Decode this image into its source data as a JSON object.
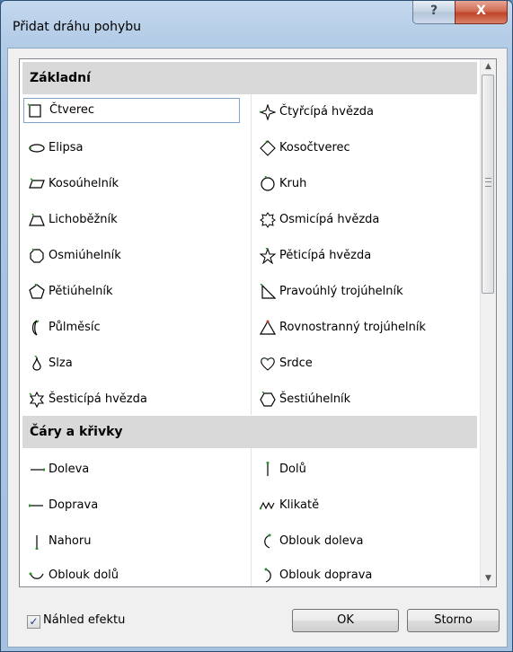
{
  "window": {
    "title": "Přidat dráhu pohybu",
    "help_label": "?",
    "close_label": "X"
  },
  "sections": [
    {
      "title": "Základní",
      "left_items": [
        {
          "label": "Čtverec",
          "icon": "square-icon"
        },
        {
          "label": "Elipsa",
          "icon": "ellipse-icon"
        },
        {
          "label": "Kosoúhelník",
          "icon": "parallelogram-icon"
        },
        {
          "label": "Lichoběžník",
          "icon": "trapezoid-icon"
        },
        {
          "label": "Osmiúhelník",
          "icon": "octagon-icon"
        },
        {
          "label": "Pětiúhelník",
          "icon": "pentagon-icon"
        },
        {
          "label": "Půlměsíc",
          "icon": "crescent-icon"
        },
        {
          "label": "Slza",
          "icon": "teardrop-icon"
        },
        {
          "label": "Šesticípá hvězda",
          "icon": "six-point-star-icon"
        }
      ],
      "right_items": [
        {
          "label": "Čtyřcípá hvězda",
          "icon": "four-point-star-icon"
        },
        {
          "label": "Kosočtverec",
          "icon": "diamond-icon"
        },
        {
          "label": "Kruh",
          "icon": "circle-icon"
        },
        {
          "label": "Osmicípá hvězda",
          "icon": "eight-point-star-icon"
        },
        {
          "label": "Pěticípá hvězda",
          "icon": "five-point-star-icon"
        },
        {
          "label": "Pravoúhlý trojúhelník",
          "icon": "right-triangle-icon"
        },
        {
          "label": "Rovnostranný trojúhelník",
          "icon": "equilateral-triangle-icon"
        },
        {
          "label": "Srdce",
          "icon": "heart-icon"
        },
        {
          "label": "Šestiúhelník",
          "icon": "hexagon-icon"
        }
      ]
    },
    {
      "title": "Čáry a křivky",
      "left_items": [
        {
          "label": "Doleva",
          "icon": "line-left-icon"
        },
        {
          "label": "Doprava",
          "icon": "line-right-icon"
        },
        {
          "label": "Nahoru",
          "icon": "line-up-icon"
        },
        {
          "label": "Oblouk dolů",
          "icon": "arc-down-icon"
        }
      ],
      "right_items": [
        {
          "label": "Dolů",
          "icon": "line-down-icon"
        },
        {
          "label": "Klikatě",
          "icon": "zigzag-icon"
        },
        {
          "label": "Oblouk doleva",
          "icon": "arc-left-icon"
        },
        {
          "label": "Oblouk doprava",
          "icon": "arc-right-icon"
        }
      ]
    }
  ],
  "selected_item": "Čtverec",
  "preview": {
    "label": "Náhled efektu",
    "checked": true
  },
  "buttons": {
    "ok": "OK",
    "cancel": "Storno"
  }
}
